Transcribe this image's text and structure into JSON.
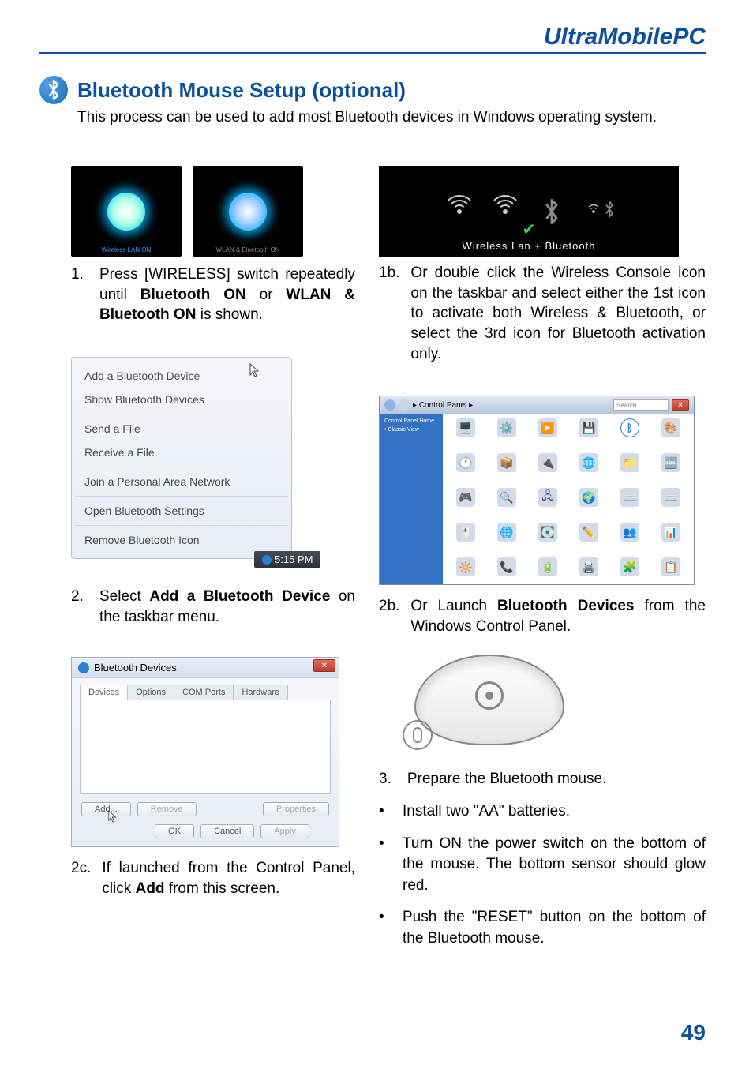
{
  "header": {
    "product": "UltraMobilePC"
  },
  "section": {
    "title": "Bluetooth Mouse Setup (optional)",
    "intro": "This process can be used to add most Bluetooth devices in Windows operating system."
  },
  "thumbs": {
    "left_caption": "Wireless LAN ON",
    "right_caption": "WLAN & Bluetooth ON"
  },
  "wireless_bar": {
    "caption": "Wireless Lan + Bluetooth"
  },
  "steps": {
    "s1_num": "1.",
    "s1_a": "Press [WIRELESS] switch repeatedly until ",
    "s1_b1": "Bluetooth ON",
    "s1_mid": " or ",
    "s1_b2": "WLAN & Bluetooth ON",
    "s1_c": " is shown.",
    "s1b_num": "1b.",
    "s1b": "Or double click the Wireless Console icon on the taskbar and select either the 1st icon to activate both Wireless & Bluetooth, or select the 3rd icon for Bluetooth activation only.",
    "s2_num": "2.",
    "s2_a": "Select ",
    "s2_b": "Add a Bluetooth Device",
    "s2_c": " on the taskbar menu.",
    "s2b_num": "2b.",
    "s2b_a": "Or Launch ",
    "s2b_b": "Bluetooth Devices",
    "s2b_c": " from the Windows Control Panel.",
    "s2c_num": "2c.",
    "s2c_a": "If launched from the Control Panel, click ",
    "s2c_b": "Add",
    "s2c_c": " from this screen.",
    "s3_num": "3.",
    "s3": "Prepare the Bluetooth mouse.",
    "b1": "Install two \"AA\" batteries.",
    "b2": "Turn ON the power switch on the bottom of the mouse. The bottom sensor should glow red.",
    "b3": "Push the \"RESET\" button on the bottom of the Bluetooth mouse."
  },
  "context_menu": {
    "items": [
      "Add a Bluetooth Device",
      "Show Bluetooth Devices",
      "Send a File",
      "Receive a File",
      "Join a Personal Area Network",
      "Open Bluetooth Settings",
      "Remove Bluetooth Icon"
    ],
    "clock": "5:15 PM"
  },
  "control_panel": {
    "breadcrumb": "Control Panel",
    "side1": "Control Panel Home",
    "side2": "Classic View",
    "search_placeholder": "Search"
  },
  "bt_dialog": {
    "title": "Bluetooth Devices",
    "tabs": [
      "Devices",
      "Options",
      "COM Ports",
      "Hardware"
    ],
    "buttons": {
      "add": "Add...",
      "remove": "Remove",
      "properties": "Properties",
      "ok": "OK",
      "cancel": "Cancel",
      "apply": "Apply"
    }
  },
  "page_number": "49",
  "bullet_char": "•"
}
